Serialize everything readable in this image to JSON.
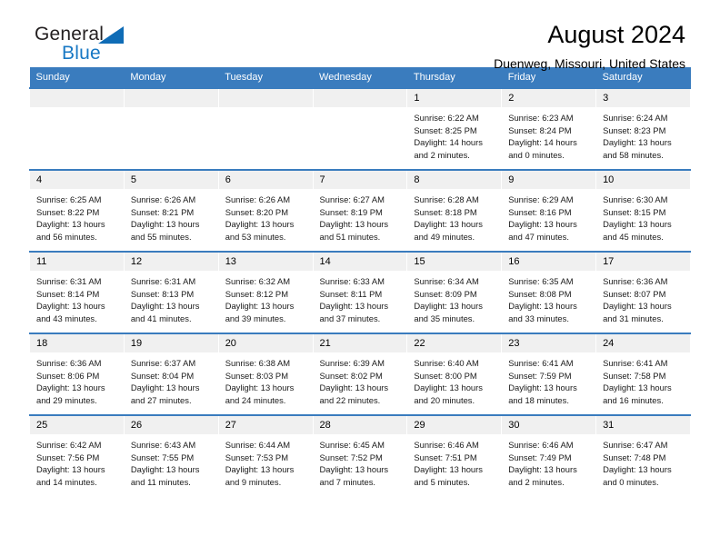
{
  "brand": {
    "name_part1": "General",
    "name_part2": "Blue",
    "triangle_icon": "triangle-icon",
    "colors": {
      "black": "#231f20",
      "blue": "#1878c4",
      "triangle": "#0f6cb6"
    }
  },
  "header": {
    "title": "August 2024",
    "subtitle": "Duenweg, Missouri, United States"
  },
  "calendar": {
    "header_bg": "#3a7cbe",
    "daynum_bg": "#f0f0f0",
    "weekdays": [
      "Sunday",
      "Monday",
      "Tuesday",
      "Wednesday",
      "Thursday",
      "Friday",
      "Saturday"
    ],
    "labels": {
      "sunrise_prefix": "Sunrise:",
      "sunset_prefix": "Sunset:",
      "daylight_prefix": "Daylight:"
    },
    "weeks": [
      [
        {
          "day": "",
          "empty": true
        },
        {
          "day": "",
          "empty": true
        },
        {
          "day": "",
          "empty": true
        },
        {
          "day": "",
          "empty": true
        },
        {
          "day": "1",
          "sunrise": "Sunrise: 6:22 AM",
          "sunset": "Sunset: 8:25 PM",
          "daylight_line1": "Daylight: 14 hours",
          "daylight_line2": "and 2 minutes."
        },
        {
          "day": "2",
          "sunrise": "Sunrise: 6:23 AM",
          "sunset": "Sunset: 8:24 PM",
          "daylight_line1": "Daylight: 14 hours",
          "daylight_line2": "and 0 minutes."
        },
        {
          "day": "3",
          "sunrise": "Sunrise: 6:24 AM",
          "sunset": "Sunset: 8:23 PM",
          "daylight_line1": "Daylight: 13 hours",
          "daylight_line2": "and 58 minutes."
        }
      ],
      [
        {
          "day": "4",
          "sunrise": "Sunrise: 6:25 AM",
          "sunset": "Sunset: 8:22 PM",
          "daylight_line1": "Daylight: 13 hours",
          "daylight_line2": "and 56 minutes."
        },
        {
          "day": "5",
          "sunrise": "Sunrise: 6:26 AM",
          "sunset": "Sunset: 8:21 PM",
          "daylight_line1": "Daylight: 13 hours",
          "daylight_line2": "and 55 minutes."
        },
        {
          "day": "6",
          "sunrise": "Sunrise: 6:26 AM",
          "sunset": "Sunset: 8:20 PM",
          "daylight_line1": "Daylight: 13 hours",
          "daylight_line2": "and 53 minutes."
        },
        {
          "day": "7",
          "sunrise": "Sunrise: 6:27 AM",
          "sunset": "Sunset: 8:19 PM",
          "daylight_line1": "Daylight: 13 hours",
          "daylight_line2": "and 51 minutes."
        },
        {
          "day": "8",
          "sunrise": "Sunrise: 6:28 AM",
          "sunset": "Sunset: 8:18 PM",
          "daylight_line1": "Daylight: 13 hours",
          "daylight_line2": "and 49 minutes."
        },
        {
          "day": "9",
          "sunrise": "Sunrise: 6:29 AM",
          "sunset": "Sunset: 8:16 PM",
          "daylight_line1": "Daylight: 13 hours",
          "daylight_line2": "and 47 minutes."
        },
        {
          "day": "10",
          "sunrise": "Sunrise: 6:30 AM",
          "sunset": "Sunset: 8:15 PM",
          "daylight_line1": "Daylight: 13 hours",
          "daylight_line2": "and 45 minutes."
        }
      ],
      [
        {
          "day": "11",
          "sunrise": "Sunrise: 6:31 AM",
          "sunset": "Sunset: 8:14 PM",
          "daylight_line1": "Daylight: 13 hours",
          "daylight_line2": "and 43 minutes."
        },
        {
          "day": "12",
          "sunrise": "Sunrise: 6:31 AM",
          "sunset": "Sunset: 8:13 PM",
          "daylight_line1": "Daylight: 13 hours",
          "daylight_line2": "and 41 minutes."
        },
        {
          "day": "13",
          "sunrise": "Sunrise: 6:32 AM",
          "sunset": "Sunset: 8:12 PM",
          "daylight_line1": "Daylight: 13 hours",
          "daylight_line2": "and 39 minutes."
        },
        {
          "day": "14",
          "sunrise": "Sunrise: 6:33 AM",
          "sunset": "Sunset: 8:11 PM",
          "daylight_line1": "Daylight: 13 hours",
          "daylight_line2": "and 37 minutes."
        },
        {
          "day": "15",
          "sunrise": "Sunrise: 6:34 AM",
          "sunset": "Sunset: 8:09 PM",
          "daylight_line1": "Daylight: 13 hours",
          "daylight_line2": "and 35 minutes."
        },
        {
          "day": "16",
          "sunrise": "Sunrise: 6:35 AM",
          "sunset": "Sunset: 8:08 PM",
          "daylight_line1": "Daylight: 13 hours",
          "daylight_line2": "and 33 minutes."
        },
        {
          "day": "17",
          "sunrise": "Sunrise: 6:36 AM",
          "sunset": "Sunset: 8:07 PM",
          "daylight_line1": "Daylight: 13 hours",
          "daylight_line2": "and 31 minutes."
        }
      ],
      [
        {
          "day": "18",
          "sunrise": "Sunrise: 6:36 AM",
          "sunset": "Sunset: 8:06 PM",
          "daylight_line1": "Daylight: 13 hours",
          "daylight_line2": "and 29 minutes."
        },
        {
          "day": "19",
          "sunrise": "Sunrise: 6:37 AM",
          "sunset": "Sunset: 8:04 PM",
          "daylight_line1": "Daylight: 13 hours",
          "daylight_line2": "and 27 minutes."
        },
        {
          "day": "20",
          "sunrise": "Sunrise: 6:38 AM",
          "sunset": "Sunset: 8:03 PM",
          "daylight_line1": "Daylight: 13 hours",
          "daylight_line2": "and 24 minutes."
        },
        {
          "day": "21",
          "sunrise": "Sunrise: 6:39 AM",
          "sunset": "Sunset: 8:02 PM",
          "daylight_line1": "Daylight: 13 hours",
          "daylight_line2": "and 22 minutes."
        },
        {
          "day": "22",
          "sunrise": "Sunrise: 6:40 AM",
          "sunset": "Sunset: 8:00 PM",
          "daylight_line1": "Daylight: 13 hours",
          "daylight_line2": "and 20 minutes."
        },
        {
          "day": "23",
          "sunrise": "Sunrise: 6:41 AM",
          "sunset": "Sunset: 7:59 PM",
          "daylight_line1": "Daylight: 13 hours",
          "daylight_line2": "and 18 minutes."
        },
        {
          "day": "24",
          "sunrise": "Sunrise: 6:41 AM",
          "sunset": "Sunset: 7:58 PM",
          "daylight_line1": "Daylight: 13 hours",
          "daylight_line2": "and 16 minutes."
        }
      ],
      [
        {
          "day": "25",
          "sunrise": "Sunrise: 6:42 AM",
          "sunset": "Sunset: 7:56 PM",
          "daylight_line1": "Daylight: 13 hours",
          "daylight_line2": "and 14 minutes."
        },
        {
          "day": "26",
          "sunrise": "Sunrise: 6:43 AM",
          "sunset": "Sunset: 7:55 PM",
          "daylight_line1": "Daylight: 13 hours",
          "daylight_line2": "and 11 minutes."
        },
        {
          "day": "27",
          "sunrise": "Sunrise: 6:44 AM",
          "sunset": "Sunset: 7:53 PM",
          "daylight_line1": "Daylight: 13 hours",
          "daylight_line2": "and 9 minutes."
        },
        {
          "day": "28",
          "sunrise": "Sunrise: 6:45 AM",
          "sunset": "Sunset: 7:52 PM",
          "daylight_line1": "Daylight: 13 hours",
          "daylight_line2": "and 7 minutes."
        },
        {
          "day": "29",
          "sunrise": "Sunrise: 6:46 AM",
          "sunset": "Sunset: 7:51 PM",
          "daylight_line1": "Daylight: 13 hours",
          "daylight_line2": "and 5 minutes."
        },
        {
          "day": "30",
          "sunrise": "Sunrise: 6:46 AM",
          "sunset": "Sunset: 7:49 PM",
          "daylight_line1": "Daylight: 13 hours",
          "daylight_line2": "and 2 minutes."
        },
        {
          "day": "31",
          "sunrise": "Sunrise: 6:47 AM",
          "sunset": "Sunset: 7:48 PM",
          "daylight_line1": "Daylight: 13 hours",
          "daylight_line2": "and 0 minutes."
        }
      ]
    ]
  }
}
